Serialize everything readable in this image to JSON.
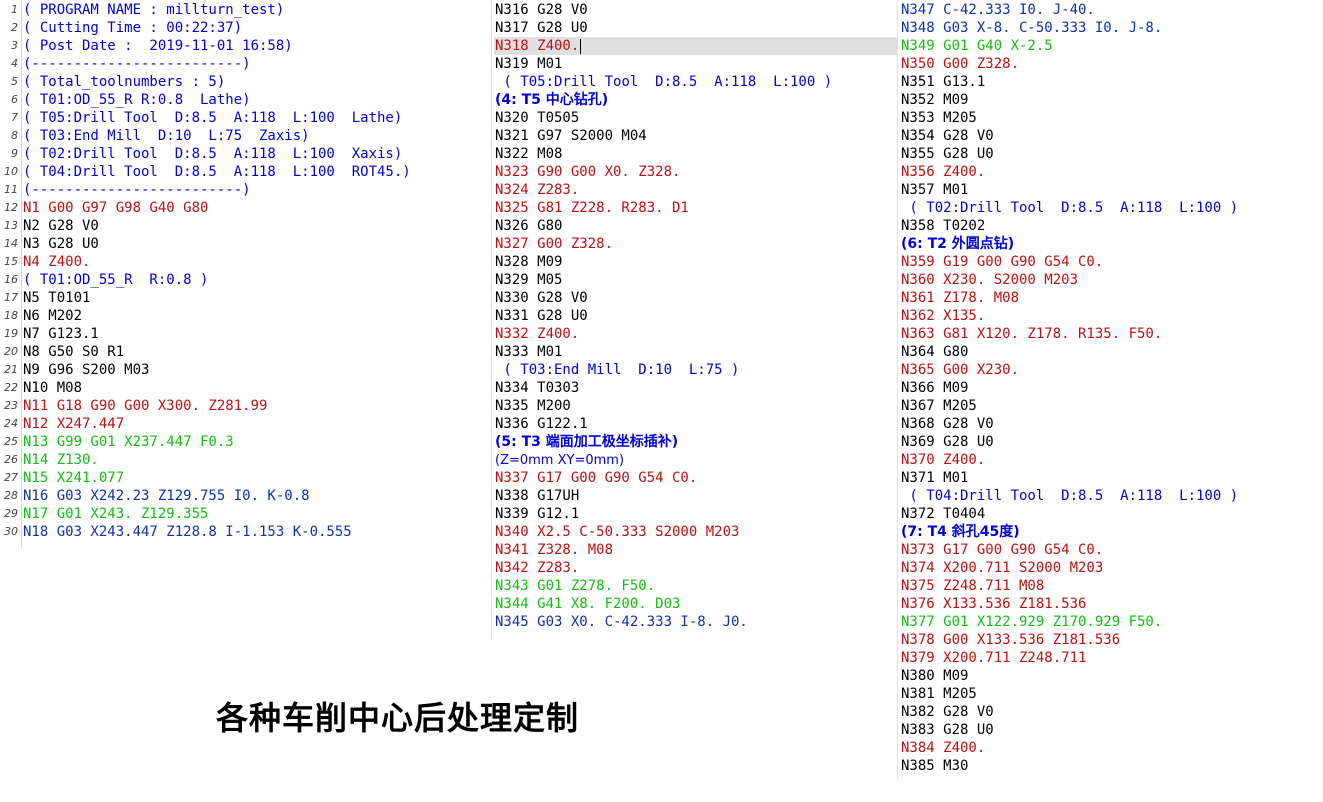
{
  "colors": {
    "comment": "#0000dd",
    "plain": "#000000",
    "rapid": "#c01010",
    "feed": "#10c010",
    "arc": "#1030b0",
    "current_line_highlight": "#e0e0e0"
  },
  "banner": "各种车削中心后处理定制",
  "panes": [
    {
      "show_line_numbers": true,
      "lines": [
        {
          "n": "1",
          "text": "( PROGRAM NAME : millturn_test)",
          "type": "comment"
        },
        {
          "n": "2",
          "text": "( Cutting Time : 00:22:37)",
          "type": "comment"
        },
        {
          "n": "3",
          "text": "( Post Date :  2019-11-01 16:58)",
          "type": "comment"
        },
        {
          "n": "4",
          "text": "(-------------------------)",
          "type": "comment"
        },
        {
          "n": "5",
          "text": "( Total_toolnumbers : 5)",
          "type": "comment"
        },
        {
          "n": "6",
          "text": "( T01:OD_55_R R:0.8  Lathe)",
          "type": "comment"
        },
        {
          "n": "7",
          "text": "( T05:Drill Tool  D:8.5  A:118  L:100  Lathe)",
          "type": "comment"
        },
        {
          "n": "8",
          "text": "( T03:End Mill  D:10  L:75  Zaxis)",
          "type": "comment"
        },
        {
          "n": "9",
          "text": "( T02:Drill Tool  D:8.5  A:118  L:100  Xaxis)",
          "type": "comment"
        },
        {
          "n": "10",
          "text": "( T04:Drill Tool  D:8.5  A:118  L:100  ROT45.)",
          "type": "comment"
        },
        {
          "n": "11",
          "text": "(-------------------------)",
          "type": "comment"
        },
        {
          "n": "12",
          "text": "N1 G00 G97 G98 G40 G80",
          "type": "rapid"
        },
        {
          "n": "13",
          "text": "N2 G28 V0",
          "type": "plain"
        },
        {
          "n": "14",
          "text": "N3 G28 U0",
          "type": "plain"
        },
        {
          "n": "15",
          "text": "N4 Z400.",
          "type": "rapid"
        },
        {
          "n": "16",
          "text": "( T01:OD_55_R  R:0.8 )",
          "type": "comment"
        },
        {
          "n": "17",
          "text": "N5 T0101",
          "type": "plain"
        },
        {
          "n": "18",
          "text": "N6 M202",
          "type": "plain"
        },
        {
          "n": "19",
          "text": "N7 G123.1",
          "type": "plain"
        },
        {
          "n": "20",
          "text": "N8 G50 S0 R1",
          "type": "plain"
        },
        {
          "n": "21",
          "text": "N9 G96 S200 M03",
          "type": "plain"
        },
        {
          "n": "22",
          "text": "N10 M08",
          "type": "plain"
        },
        {
          "n": "23",
          "text": "N11 G18 G90 G00 X300. Z281.99",
          "type": "rapid"
        },
        {
          "n": "24",
          "text": "N12 X247.447",
          "type": "rapid"
        },
        {
          "n": "25",
          "text": "N13 G99 G01 X237.447 F0.3",
          "type": "feed"
        },
        {
          "n": "26",
          "text": "N14 Z130.",
          "type": "feed"
        },
        {
          "n": "27",
          "text": "N15 X241.077",
          "type": "feed"
        },
        {
          "n": "28",
          "text": "N16 G03 X242.23 Z129.755 I0. K-0.8",
          "type": "arc"
        },
        {
          "n": "29",
          "text": "N17 G01 X243. Z129.355",
          "type": "feed"
        },
        {
          "n": "30",
          "text": "N18 G03 X243.447 Z128.8 I-1.153 K-0.555",
          "type": "arc"
        }
      ]
    },
    {
      "show_line_numbers": false,
      "lines": [
        {
          "text": "N316 G28 V0",
          "type": "plain"
        },
        {
          "text": "N317 G28 U0",
          "type": "plain"
        },
        {
          "text": "N318 Z400.",
          "type": "rapid",
          "current": true
        },
        {
          "text": "N319 M01",
          "type": "plain"
        },
        {
          "text": " ( T05:Drill Tool  D:8.5  A:118  L:100 )",
          "type": "comment"
        },
        {
          "text": "(4: T5 中心钻孔)",
          "type": "heading"
        },
        {
          "text": "N320 T0505",
          "type": "plain"
        },
        {
          "text": "N321 G97 S2000 M04",
          "type": "plain"
        },
        {
          "text": "N322 M08",
          "type": "plain"
        },
        {
          "text": "N323 G90 G00 X0. Z328.",
          "type": "rapid"
        },
        {
          "text": "N324 Z283.",
          "type": "rapid"
        },
        {
          "text": "N325 G81 Z228. R283. D1",
          "type": "rapid"
        },
        {
          "text": "N326 G80",
          "type": "plain"
        },
        {
          "text": "N327 G00 Z328.",
          "type": "rapid"
        },
        {
          "text": "N328 M09",
          "type": "plain"
        },
        {
          "text": "N329 M05",
          "type": "plain"
        },
        {
          "text": "N330 G28 V0",
          "type": "plain"
        },
        {
          "text": "N331 G28 U0",
          "type": "plain"
        },
        {
          "text": "N332 Z400.",
          "type": "rapid"
        },
        {
          "text": "N333 M01",
          "type": "plain"
        },
        {
          "text": " ( T03:End Mill  D:10  L:75 )",
          "type": "comment"
        },
        {
          "text": "N334 T0303",
          "type": "plain"
        },
        {
          "text": "N335 M200",
          "type": "plain"
        },
        {
          "text": "N336 G122.1",
          "type": "plain"
        },
        {
          "text": "(5: T3 端面加工极坐标插补)",
          "type": "heading"
        },
        {
          "text": "(Z=0mm XY=0mm)",
          "type": "sub"
        },
        {
          "text": "N337 G17 G00 G90 G54 C0.",
          "type": "rapid"
        },
        {
          "text": "N338 G17UH",
          "type": "plain"
        },
        {
          "text": "N339 G12.1",
          "type": "plain"
        },
        {
          "text": "N340 X2.5 C-50.333 S2000 M203",
          "type": "rapid"
        },
        {
          "text": "N341 Z328. M08",
          "type": "rapid"
        },
        {
          "text": "N342 Z283.",
          "type": "rapid"
        },
        {
          "text": "N343 G01 Z278. F50.",
          "type": "feed"
        },
        {
          "text": "N344 G41 X8. F200. D03",
          "type": "feed"
        },
        {
          "text": "N345 G03 X0. C-42.333 I-8. J0.",
          "type": "arc"
        }
      ]
    },
    {
      "show_line_numbers": false,
      "lines": [
        {
          "text": "N347 C-42.333 I0. J-40.",
          "type": "arc"
        },
        {
          "text": "N348 G03 X-8. C-50.333 I0. J-8.",
          "type": "arc"
        },
        {
          "text": "N349 G01 G40 X-2.5",
          "type": "feed"
        },
        {
          "text": "N350 G00 Z328.",
          "type": "rapid"
        },
        {
          "text": "N351 G13.1",
          "type": "plain"
        },
        {
          "text": "N352 M09",
          "type": "plain"
        },
        {
          "text": "N353 M205",
          "type": "plain"
        },
        {
          "text": "N354 G28 V0",
          "type": "plain"
        },
        {
          "text": "N355 G28 U0",
          "type": "plain"
        },
        {
          "text": "N356 Z400.",
          "type": "rapid"
        },
        {
          "text": "N357 M01",
          "type": "plain"
        },
        {
          "text": " ( T02:Drill Tool  D:8.5  A:118  L:100 )",
          "type": "comment"
        },
        {
          "text": "N358 T0202",
          "type": "plain"
        },
        {
          "text": "(6: T2 外圆点钻)",
          "type": "heading"
        },
        {
          "text": "N359 G19 G00 G90 G54 C0.",
          "type": "rapid"
        },
        {
          "text": "N360 X230. S2000 M203",
          "type": "rapid"
        },
        {
          "text": "N361 Z178. M08",
          "type": "rapid"
        },
        {
          "text": "N362 X135.",
          "type": "rapid"
        },
        {
          "text": "N363 G81 X120. Z178. R135. F50.",
          "type": "rapid"
        },
        {
          "text": "N364 G80",
          "type": "plain"
        },
        {
          "text": "N365 G00 X230.",
          "type": "rapid"
        },
        {
          "text": "N366 M09",
          "type": "plain"
        },
        {
          "text": "N367 M205",
          "type": "plain"
        },
        {
          "text": "N368 G28 V0",
          "type": "plain"
        },
        {
          "text": "N369 G28 U0",
          "type": "plain"
        },
        {
          "text": "N370 Z400.",
          "type": "rapid"
        },
        {
          "text": "N371 M01",
          "type": "plain"
        },
        {
          "text": " ( T04:Drill Tool  D:8.5  A:118  L:100 )",
          "type": "comment"
        },
        {
          "text": "N372 T0404",
          "type": "plain"
        },
        {
          "text": "(7: T4 斜孔45度)",
          "type": "heading"
        },
        {
          "text": "N373 G17 G00 G90 G54 C0.",
          "type": "rapid"
        },
        {
          "text": "N374 X200.711 S2000 M203",
          "type": "rapid"
        },
        {
          "text": "N375 Z248.711 M08",
          "type": "rapid"
        },
        {
          "text": "N376 X133.536 Z181.536",
          "type": "rapid"
        },
        {
          "text": "N377 G01 X122.929 Z170.929 F50.",
          "type": "feed"
        },
        {
          "text": "N378 G00 X133.536 Z181.536",
          "type": "rapid"
        },
        {
          "text": "N379 X200.711 Z248.711",
          "type": "rapid"
        },
        {
          "text": "N380 M09",
          "type": "plain"
        },
        {
          "text": "N381 M205",
          "type": "plain"
        },
        {
          "text": "N382 G28 V0",
          "type": "plain"
        },
        {
          "text": "N383 G28 U0",
          "type": "plain"
        },
        {
          "text": "N384 Z400.",
          "type": "rapid"
        },
        {
          "text": "N385 M30",
          "type": "plain"
        }
      ]
    }
  ]
}
